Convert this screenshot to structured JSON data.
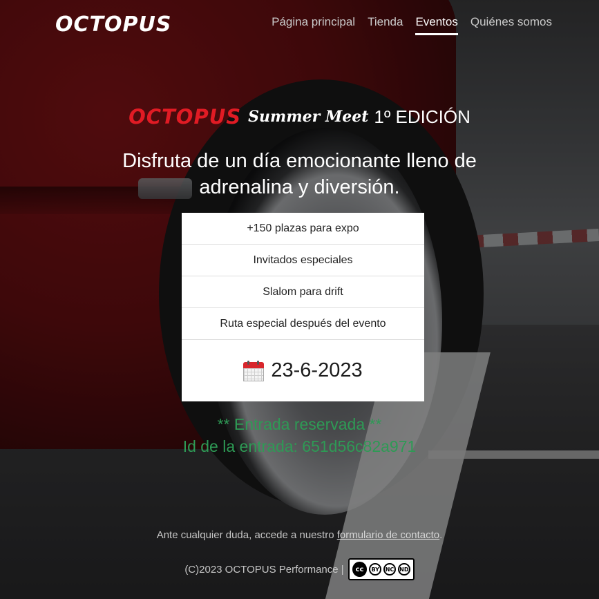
{
  "header": {
    "logo": "OCTOPUS",
    "nav": [
      {
        "label": "Página principal",
        "active": false
      },
      {
        "label": "Tienda",
        "active": false
      },
      {
        "label": "Eventos",
        "active": true
      },
      {
        "label": "Quiénes somos",
        "active": false
      }
    ]
  },
  "event": {
    "brand": "OCTOPUS",
    "name": "Summer Meet",
    "edition": "1º EDICIÓN",
    "tagline": "Disfruta de un día emocionante lleno de adrenalina y diversión."
  },
  "features": [
    "+150 plazas para expo",
    "Invitados especiales",
    "Slalom para drift",
    "Ruta especial después del evento"
  ],
  "date": "23-6-2023",
  "reservation": {
    "status": "** Entrada reservada **",
    "ticket_id": "Id de la entrada: 651d56c82a971"
  },
  "footer": {
    "help_prefix": "Ante cualquier duda, accede a nuestro",
    "help_link": "formulario de contacto",
    "help_suffix": ".",
    "copyright": "(C)2023 OCTOPUS Performance |",
    "license_labels": [
      "BY",
      "NC",
      "ND"
    ]
  },
  "colors": {
    "brand_red": "#e01b24",
    "reservation_green": "#2e9a55",
    "card_bg": "#ffffff"
  },
  "icons": {
    "date": "calendar-icon",
    "license": "creative-commons-badge"
  }
}
